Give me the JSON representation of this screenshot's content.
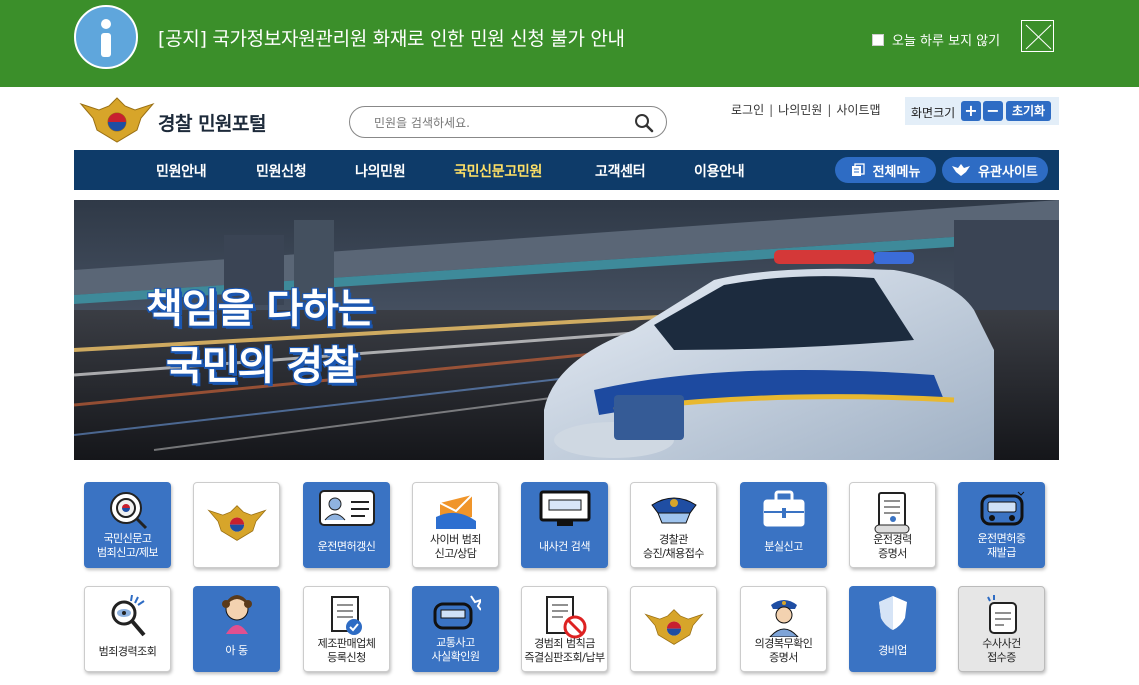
{
  "notice": {
    "text": "[공지] 국가정보자원관리원 화재로 인한 민원 신청 불가 안내",
    "dismiss_label": "오늘 하루 보지 않기"
  },
  "header": {
    "site_title": "경찰 민원포털",
    "search_placeholder": "민원을 검색하세요.",
    "util_links": [
      "로그인",
      "나의민원",
      "사이트맵"
    ],
    "zoom_label": "화면크기",
    "zoom_in": "+",
    "zoom_out": "−",
    "zoom_reset": "초기화"
  },
  "nav": {
    "items": [
      "민원안내",
      "민원신청",
      "나의민원",
      "국민신문고민원",
      "고객센터",
      "이용안내"
    ],
    "active": "국민신문고민원",
    "all_menu": "전체메뉴",
    "related_sites": "유관사이트"
  },
  "banner": {
    "line1": "책임을 다하는",
    "line2": "국민의 경찰"
  },
  "services": {
    "row1": [
      {
        "label": "국민신문고\n범죄신고/제보",
        "icon": "report-target-icon",
        "style": "blue"
      },
      {
        "label": "",
        "icon": "police-emblem-icon",
        "style": "white"
      },
      {
        "label": "운전면허갱신",
        "icon": "license-card-icon",
        "style": "blue"
      },
      {
        "label": "사이버 범죄\n신고/상담",
        "icon": "cyber-mail-icon",
        "style": "white"
      },
      {
        "label": "내사건 검색",
        "icon": "monitor-search-icon",
        "style": "blue"
      },
      {
        "label": "경찰관\n승진/채용접수",
        "icon": "police-cap-icon",
        "style": "white"
      },
      {
        "label": "분실신고",
        "icon": "lost-bag-icon",
        "style": "blue"
      },
      {
        "label": "운전경력\n증명서",
        "icon": "certificate-scroll-icon",
        "style": "white"
      },
      {
        "label": "운전면허증\n재발급",
        "icon": "bus-reissue-icon",
        "style": "blue"
      }
    ],
    "row2": [
      {
        "label": "범죄경력조회",
        "icon": "magnifier-eye-icon",
        "style": "white"
      },
      {
        "label": "아 동",
        "icon": "child-icon",
        "style": "blue"
      },
      {
        "label": "제조판매업체\n등록신청",
        "icon": "document-check-icon",
        "style": "white"
      },
      {
        "label": "교통사고\n사실확인원",
        "icon": "car-accident-icon",
        "style": "blue"
      },
      {
        "label": "경범죄 범칙금\n즉결심판조회/납부",
        "icon": "fine-document-icon",
        "style": "white"
      },
      {
        "label": "",
        "icon": "police-emblem-icon",
        "style": "white"
      },
      {
        "label": "의경복무확인\n증명서",
        "icon": "conscript-officer-icon",
        "style": "white"
      },
      {
        "label": "경비업",
        "icon": "shield-icon",
        "style": "blue"
      },
      {
        "label": "수사사건\n접수증",
        "icon": "case-receipt-icon",
        "style": "gray"
      }
    ]
  },
  "colors": {
    "notice_bg": "#3b8f2a",
    "nav_bg": "#0e3b69",
    "active_nav": "#ffe066",
    "tile_blue": "#3a73c3",
    "pill_blue": "#2e6cc4"
  }
}
